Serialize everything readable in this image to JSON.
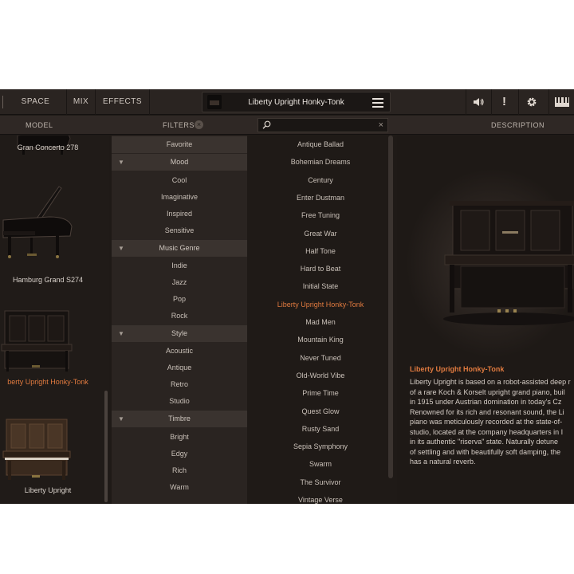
{
  "topbar": {
    "tabs": [
      "SPACE",
      "MIX",
      "EFFECTS"
    ],
    "preset_name": "Liberty Upright Honky-Tonk",
    "icons": [
      "speaker-icon",
      "alert-icon",
      "gear-icon",
      "keyboard-icon"
    ]
  },
  "headers": {
    "model": "MODEL",
    "filters": "FILTERS",
    "filters_clear": "×",
    "search_placeholder": "",
    "search_clear": "×",
    "description": "DESCRIPTION"
  },
  "models": [
    {
      "label": "Gran Concerto 278",
      "active": false
    },
    {
      "label": "Hamburg Grand S274",
      "active": false
    },
    {
      "label": "berty Upright Honky-Tonk",
      "active": true
    },
    {
      "label": "Liberty Upright",
      "active": false
    }
  ],
  "filters": {
    "favorite": "Favorite",
    "groups": [
      {
        "label": "Mood",
        "items": [
          "Cool",
          "Imaginative",
          "Inspired",
          "Sensitive"
        ]
      },
      {
        "label": "Music Genre",
        "items": [
          "Indie",
          "Jazz",
          "Pop",
          "Rock"
        ]
      },
      {
        "label": "Style",
        "items": [
          "Acoustic",
          "Antique",
          "Retro",
          "Studio"
        ]
      },
      {
        "label": "Timbre",
        "items": [
          "Bright",
          "Edgy",
          "Rich",
          "Warm"
        ]
      }
    ]
  },
  "presets": {
    "items": [
      "Antique Ballad",
      "Bohemian Dreams",
      "Century",
      "Enter Dustman",
      "Free Tuning",
      "Great War",
      "Half Tone",
      "Hard to Beat",
      "Initial State",
      "Liberty Upright Honky-Tonk",
      "Mad Men",
      "Mountain King",
      "Never Tuned",
      "Old-World Vibe",
      "Prime Time",
      "Quest Glow",
      "Rusty Sand",
      "Sepia Symphony",
      "Swarm",
      "The Survivor",
      "Vintage Verse"
    ],
    "active": "Liberty Upright Honky-Tonk"
  },
  "description": {
    "title": "Liberty Upright Honky-Tonk",
    "lines": [
      "Liberty Upright is based on a robot-assisted deep r",
      "of a rare Koch & Korselt upright grand piano, buil",
      "in 1915 under Austrian domination in today's Cz",
      "Renowned for its rich and resonant sound, the Li",
      "piano was meticulously recorded at the state-of-",
      "studio, located at the company headquarters in I",
      "in its authentic \"riserva\" state. Naturally detune",
      "of settling and with beautifully soft damping, the",
      "has a natural reverb."
    ]
  },
  "colors": {
    "accent": "#e07a3f",
    "background": "#1f1a17",
    "panel": "#2a2421"
  }
}
